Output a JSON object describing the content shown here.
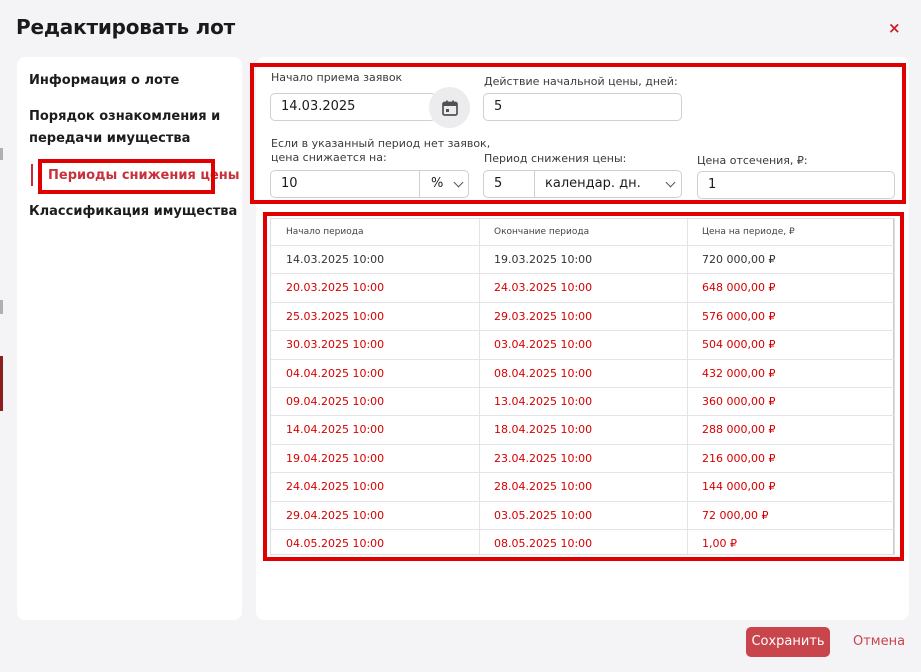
{
  "dialog": {
    "title": "Редактировать лот",
    "close_label": "×"
  },
  "nav": {
    "items": [
      {
        "label": "Информация о лоте"
      },
      {
        "label": "Порядок ознакомления и"
      },
      {
        "label": "передачи имущества"
      },
      {
        "label": "Периоды снижения цены"
      },
      {
        "label": "Классификация имущества"
      }
    ],
    "active_index": 3
  },
  "form": {
    "start_label": "Начало приема заявок",
    "start_value": "14.03.2025",
    "duration_label": "Действие начальной цены, дней:",
    "duration_value": "5",
    "reduce_label_line1": "Если в указанный период нет заявок,",
    "reduce_label_line2": "цена снижается на:",
    "reduce_value": "10",
    "reduce_unit": "%",
    "period_label": "Период снижения цены:",
    "period_value": "5",
    "period_unit": "календар. дн.",
    "cutoff_label": "Цена отсечения, ₽:",
    "cutoff_value": "1"
  },
  "table": {
    "headers": [
      "Начало периода",
      "Окончание периода",
      "Цена на периоде, ₽"
    ],
    "rows": [
      {
        "start": "14.03.2025 10:00",
        "end": "19.03.2025 10:00",
        "price": "720 000,00 ₽",
        "color": "#333333"
      },
      {
        "start": "20.03.2025 10:00",
        "end": "24.03.2025 10:00",
        "price": "648 000,00 ₽",
        "color": "#d60000"
      },
      {
        "start": "25.03.2025 10:00",
        "end": "29.03.2025 10:00",
        "price": "576 000,00 ₽",
        "color": "#d60000"
      },
      {
        "start": "30.03.2025 10:00",
        "end": "03.04.2025 10:00",
        "price": "504 000,00 ₽",
        "color": "#d60000"
      },
      {
        "start": "04.04.2025 10:00",
        "end": "08.04.2025 10:00",
        "price": "432 000,00 ₽",
        "color": "#d60000"
      },
      {
        "start": "09.04.2025 10:00",
        "end": "13.04.2025 10:00",
        "price": "360 000,00 ₽",
        "color": "#d60000"
      },
      {
        "start": "14.04.2025 10:00",
        "end": "18.04.2025 10:00",
        "price": "288 000,00 ₽",
        "color": "#d60000"
      },
      {
        "start": "19.04.2025 10:00",
        "end": "23.04.2025 10:00",
        "price": "216 000,00 ₽",
        "color": "#d60000"
      },
      {
        "start": "24.04.2025 10:00",
        "end": "28.04.2025 10:00",
        "price": "144 000,00 ₽",
        "color": "#d60000"
      },
      {
        "start": "29.04.2025 10:00",
        "end": "03.05.2025 10:00",
        "price": "72 000,00 ₽",
        "color": "#d60000"
      },
      {
        "start": "04.05.2025 10:00",
        "end": "08.05.2025 10:00",
        "price": "1,00 ₽",
        "color": "#d60000"
      }
    ]
  },
  "footer": {
    "save_label": "Сохранить",
    "cancel_label": "Отмена"
  },
  "colors": {
    "accent": "#c8454c",
    "highlight": "#e10000",
    "active_nav": "#c8323c"
  }
}
